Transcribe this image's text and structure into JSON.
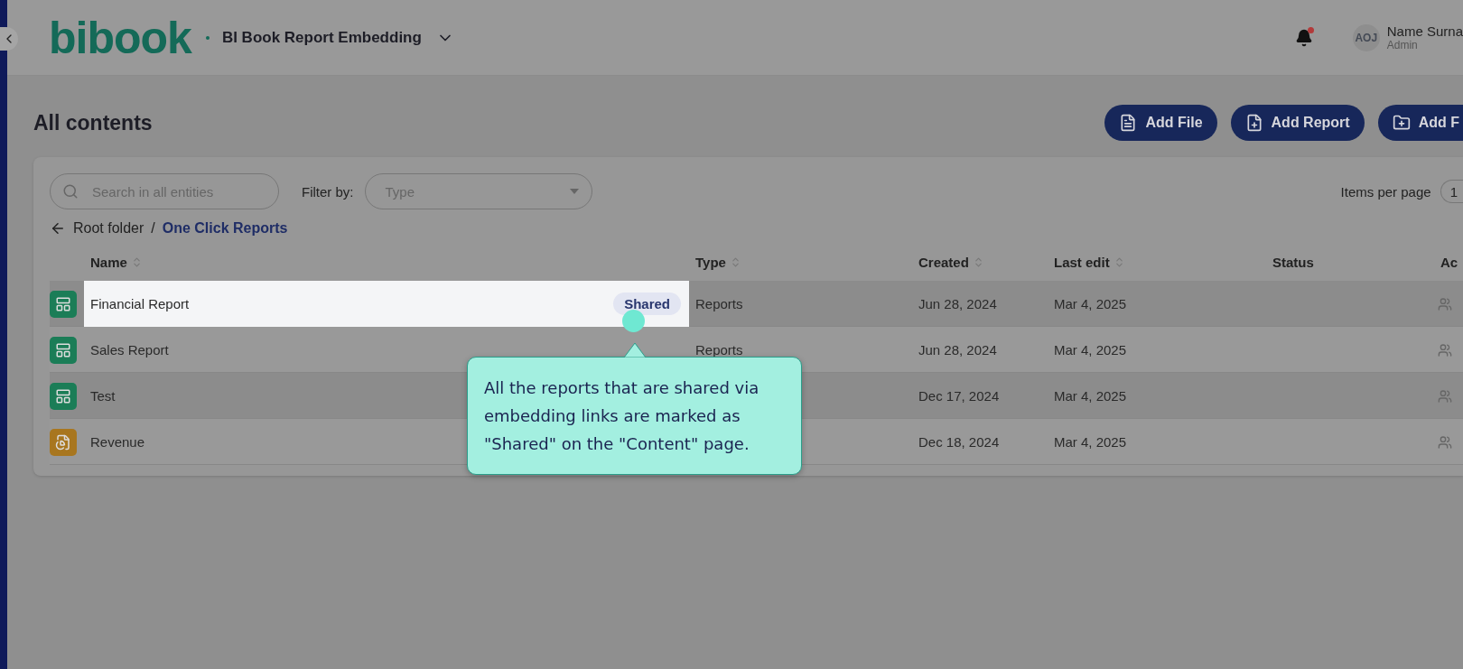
{
  "header": {
    "logo": "bibook",
    "workspace": "BI Book Report Embedding",
    "user": {
      "initials": "AOJ",
      "name": "Name Surna",
      "role": "Admin"
    },
    "notification": true
  },
  "page": {
    "title": "All contents",
    "buttons": [
      {
        "label": "Add File",
        "kind": "file"
      },
      {
        "label": "Add Report",
        "kind": "report"
      },
      {
        "label": "Add F",
        "kind": "folder"
      }
    ]
  },
  "filters": {
    "search": {
      "placeholder": "Search in all entities"
    },
    "filter_label": "Filter by:",
    "type_select": {
      "placeholder": "Type"
    },
    "items_per_page_label": "Items per page",
    "items_per_page": "1"
  },
  "breadcrumb": {
    "root": "Root folder",
    "separator": "/",
    "current": "One Click Reports"
  },
  "table": {
    "columns": [
      {
        "label": "Name",
        "sortable": true
      },
      {
        "label": "Type",
        "sortable": true
      },
      {
        "label": "Created",
        "sortable": true
      },
      {
        "label": "Last edit",
        "sortable": true
      },
      {
        "label": "Status",
        "sortable": false
      },
      {
        "label": "Ac",
        "sortable": false
      }
    ],
    "rows": [
      {
        "kind": "report",
        "name": "Financial Report",
        "badge": "Shared",
        "type": "Reports",
        "created": "Jun 28, 2024",
        "last_edit": "Mar 4, 2025",
        "highlighted": true
      },
      {
        "kind": "report",
        "name": "Sales Report",
        "type": "Reports",
        "created": "Jun 28, 2024",
        "last_edit": "Mar 4, 2025",
        "highlighted": false
      },
      {
        "kind": "report",
        "name": "Test",
        "created": "Dec 17, 2024",
        "last_edit": "Mar 4, 2025",
        "highlighted": false
      },
      {
        "kind": "analysis",
        "name": "Revenue",
        "created": "Dec 18, 2024",
        "last_edit": "Mar 4, 2025",
        "highlighted": false
      }
    ]
  },
  "tooltip": {
    "text": "All the reports that are shared via embedding links are marked as \"Shared\" on the \"Content\" page."
  }
}
